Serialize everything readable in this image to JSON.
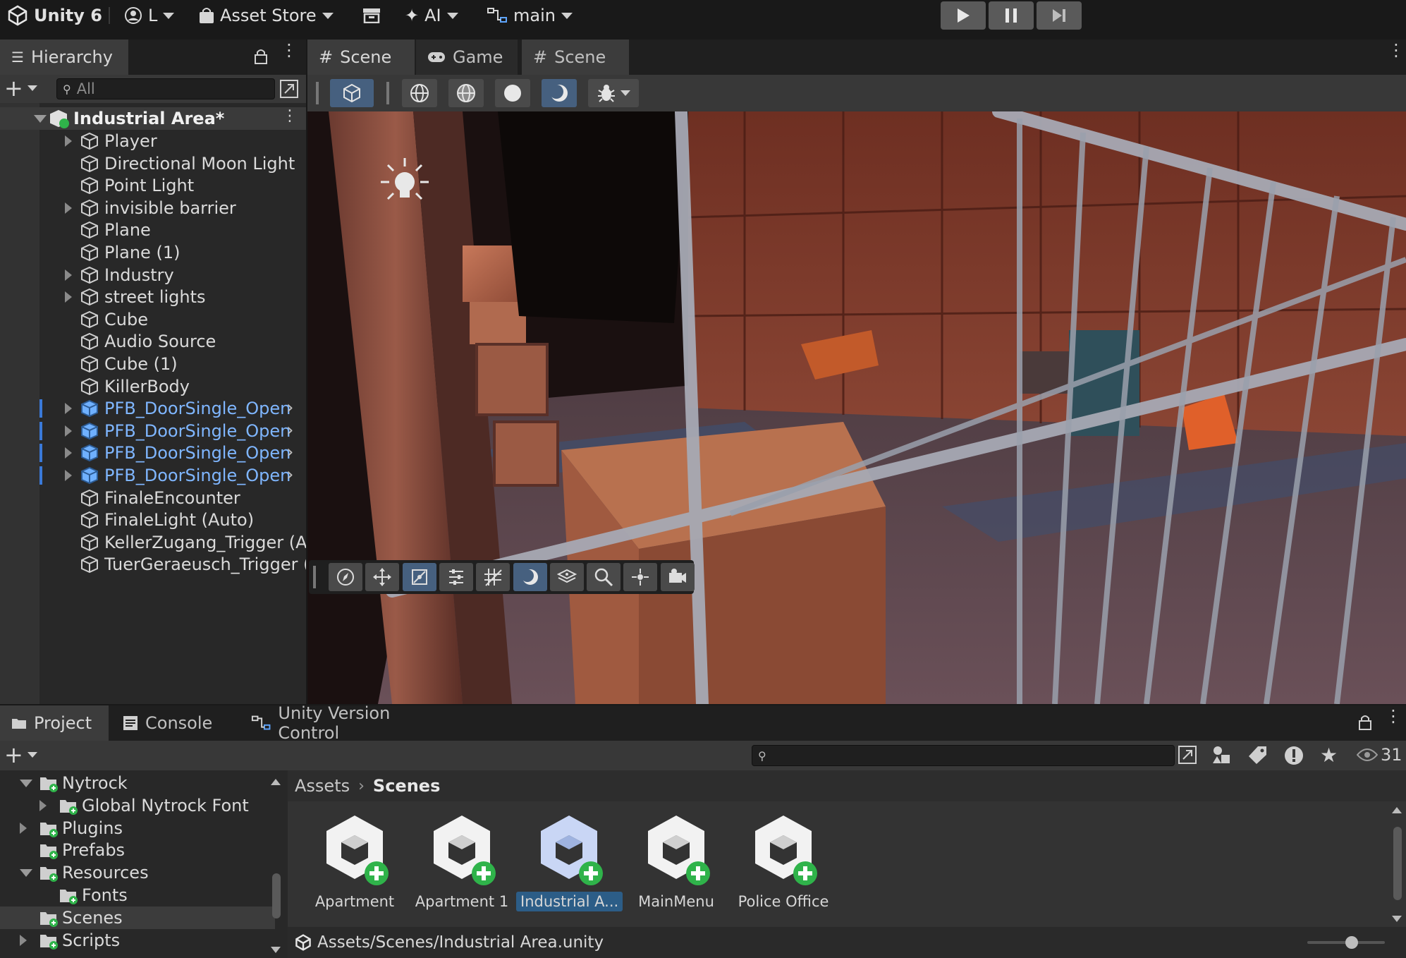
{
  "topbar": {
    "app_title": "Unity 6",
    "account_label": "L",
    "asset_store_label": "Asset Store",
    "ai_label": "AI",
    "branch_label": "main"
  },
  "hierarchy": {
    "tab_label": "Hierarchy",
    "search_placeholder": "All",
    "scene_root": "Industrial Area*",
    "items": [
      {
        "label": "Player",
        "expandable": true,
        "prefab": false
      },
      {
        "label": "Directional Moon Light",
        "expandable": false,
        "prefab": false
      },
      {
        "label": "Point Light",
        "expandable": false,
        "prefab": false
      },
      {
        "label": "invisible barrier",
        "expandable": true,
        "prefab": false
      },
      {
        "label": "Plane",
        "expandable": false,
        "prefab": false
      },
      {
        "label": "Plane (1)",
        "expandable": false,
        "prefab": false
      },
      {
        "label": "Industry",
        "expandable": true,
        "prefab": false
      },
      {
        "label": "street lights",
        "expandable": true,
        "prefab": false
      },
      {
        "label": "Cube",
        "expandable": false,
        "prefab": false
      },
      {
        "label": "Audio Source",
        "expandable": false,
        "prefab": false
      },
      {
        "label": "Cube (1)",
        "expandable": false,
        "prefab": false
      },
      {
        "label": "KillerBody",
        "expandable": false,
        "prefab": false
      },
      {
        "label": "PFB_DoorSingle_Open",
        "expandable": true,
        "prefab": true
      },
      {
        "label": "PFB_DoorSingle_Open",
        "expandable": true,
        "prefab": true
      },
      {
        "label": "PFB_DoorSingle_Open",
        "expandable": true,
        "prefab": true
      },
      {
        "label": "PFB_DoorSingle_Open",
        "expandable": true,
        "prefab": true
      },
      {
        "label": "FinaleEncounter",
        "expandable": false,
        "prefab": false
      },
      {
        "label": "FinaleLight (Auto)",
        "expandable": false,
        "prefab": false
      },
      {
        "label": "KellerZugang_Trigger (Au",
        "expandable": false,
        "prefab": false
      },
      {
        "label": "TuerGeraeusch_Trigger (/",
        "expandable": false,
        "prefab": false
      }
    ]
  },
  "scene_tabs": [
    {
      "label": "Scene",
      "icon": "grid-icon"
    },
    {
      "label": "Game",
      "icon": "gamepad-icon"
    },
    {
      "label": "Scene",
      "icon": "grid-icon"
    }
  ],
  "project": {
    "tabs": [
      {
        "label": "Project",
        "icon": "folder-icon"
      },
      {
        "label": "Console",
        "icon": "console-icon"
      },
      {
        "label": "Unity Version Control",
        "icon": "version-control-icon"
      }
    ],
    "visible_count": "31",
    "folders": [
      {
        "label": "Nytrock",
        "depth": 0,
        "state": "open"
      },
      {
        "label": "Global Nytrock Font",
        "depth": 1,
        "state": "closed"
      },
      {
        "label": "Plugins",
        "depth": 0,
        "state": "closed"
      },
      {
        "label": "Prefabs",
        "depth": 0,
        "state": "none"
      },
      {
        "label": "Resources",
        "depth": 0,
        "state": "open"
      },
      {
        "label": "Fonts",
        "depth": 1,
        "state": "none"
      },
      {
        "label": "Scenes",
        "depth": 0,
        "state": "none"
      },
      {
        "label": "Scripts",
        "depth": 0,
        "state": "closed"
      }
    ],
    "breadcrumb": [
      "Assets",
      "Scenes"
    ],
    "assets": [
      {
        "label": "Apartment"
      },
      {
        "label": "Apartment 1"
      },
      {
        "label": "Industrial A..."
      },
      {
        "label": "MainMenu"
      },
      {
        "label": "Police Office"
      }
    ],
    "status_path": "Assets/Scenes/Industrial Area.unity"
  },
  "colors": {
    "accent": "#3a79d8",
    "prefab_text": "#7fb6ff",
    "add_badge": "#2fb34a"
  }
}
